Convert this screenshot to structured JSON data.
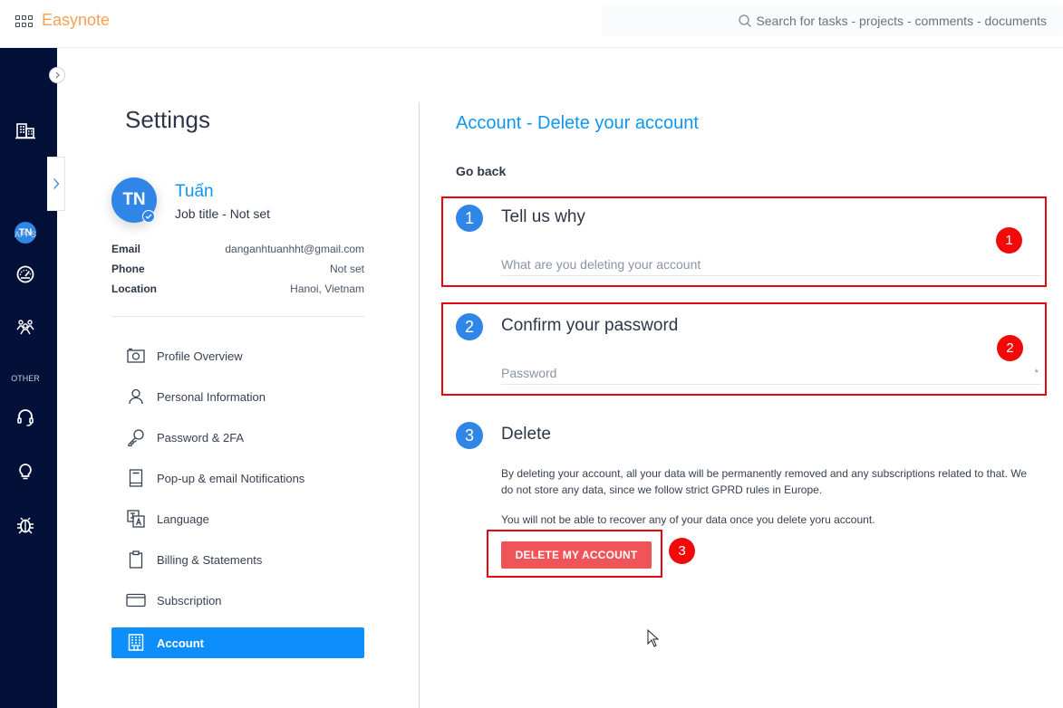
{
  "topbar": {
    "brand": "Easynote",
    "search_placeholder": "Search for tasks - projects - comments - documents"
  },
  "sidebar": {
    "avatar_initials": "TN",
    "section_apps": "APPS",
    "section_other": "OTHER",
    "icons": [
      "company-icon",
      "dashboard-icon",
      "team-icon",
      "support-icon",
      "idea-icon",
      "bug-icon"
    ]
  },
  "settings": {
    "title": "Settings",
    "profile": {
      "initials": "TN",
      "name": "Tuấn",
      "job_title": "Job title - Not set",
      "info": [
        {
          "label": "Email",
          "value": "danganhtuanhht@gmail.com"
        },
        {
          "label": "Phone",
          "value": "Not set"
        },
        {
          "label": "Location",
          "value": "Hanoi, Vietnam"
        }
      ]
    },
    "menu": [
      {
        "label": "Profile Overview",
        "icon": "camera-icon",
        "active": false
      },
      {
        "label": "Personal Information",
        "icon": "user-icon",
        "active": false
      },
      {
        "label": "Password & 2FA",
        "icon": "key-icon",
        "active": false
      },
      {
        "label": "Pop-up & email Notifications",
        "icon": "notebook-icon",
        "active": false
      },
      {
        "label": "Language",
        "icon": "translate-icon",
        "active": false
      },
      {
        "label": "Billing & Statements",
        "icon": "clipboard-icon",
        "active": false
      },
      {
        "label": "Subscription",
        "icon": "card-icon",
        "active": false
      },
      {
        "label": "Account",
        "icon": "building-icon",
        "active": true
      }
    ]
  },
  "main": {
    "title": "Account - Delete your account",
    "go_back": "Go back",
    "steps": [
      {
        "number": "1",
        "title": "Tell us why",
        "field_placeholder": "What are you deleting your account",
        "annotation": "1"
      },
      {
        "number": "2",
        "title": "Confirm your password",
        "field_placeholder": "Password",
        "required_mark": "*",
        "annotation": "2"
      },
      {
        "number": "3",
        "title": "Delete",
        "description_1": "By deleting your account, all your data will be permanently removed and any subscriptions related to that. We do not store any data, since we follow strict GPRD rules in Europe.",
        "description_2": "You will not be able to recover any of your data once you delete yoru account.",
        "button_label": "DELETE MY ACCOUNT",
        "annotation": "3"
      }
    ]
  },
  "colors": {
    "brand": "#f9a050",
    "accent": "#0d96f2",
    "sidebar_bg": "#031037",
    "danger_button": "#ef5558",
    "annotation_red": "#e8070e"
  }
}
